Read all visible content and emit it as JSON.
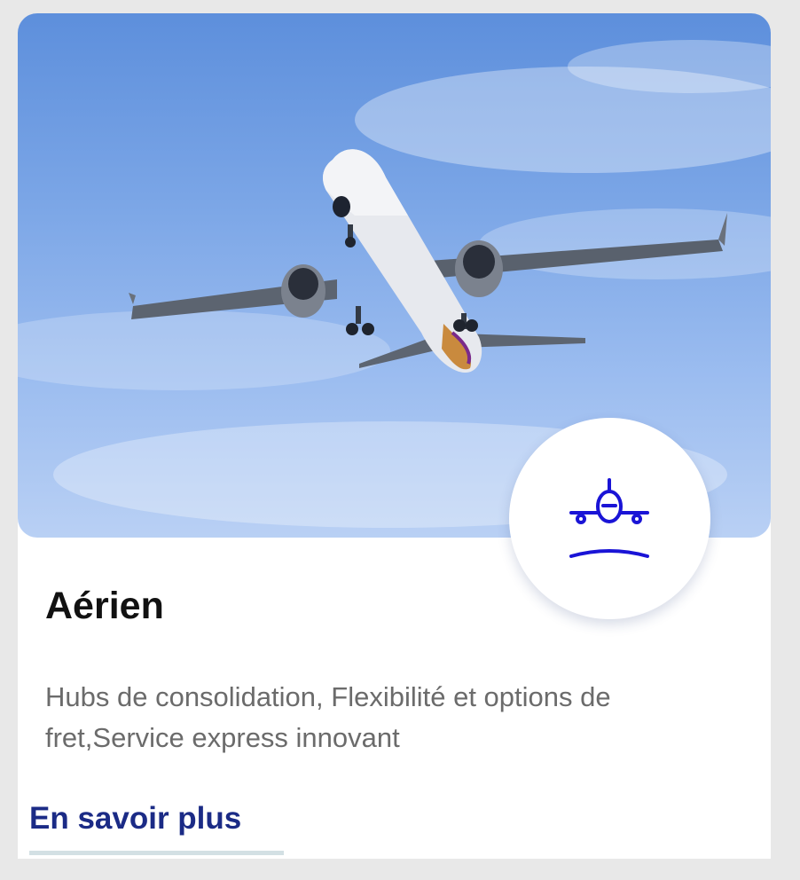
{
  "card": {
    "title": "Aérien",
    "description": "Hubs de consolidation, Flexibilité et options de fret,Service express innovant",
    "link_label": "En savoir plus",
    "hero_image": "airplane-in-sky-photo",
    "badge_icon": "airplane-landing-icon",
    "colors": {
      "icon": "#1a14d6",
      "link": "#1b2b86",
      "underline": "#d3e0e4"
    }
  }
}
